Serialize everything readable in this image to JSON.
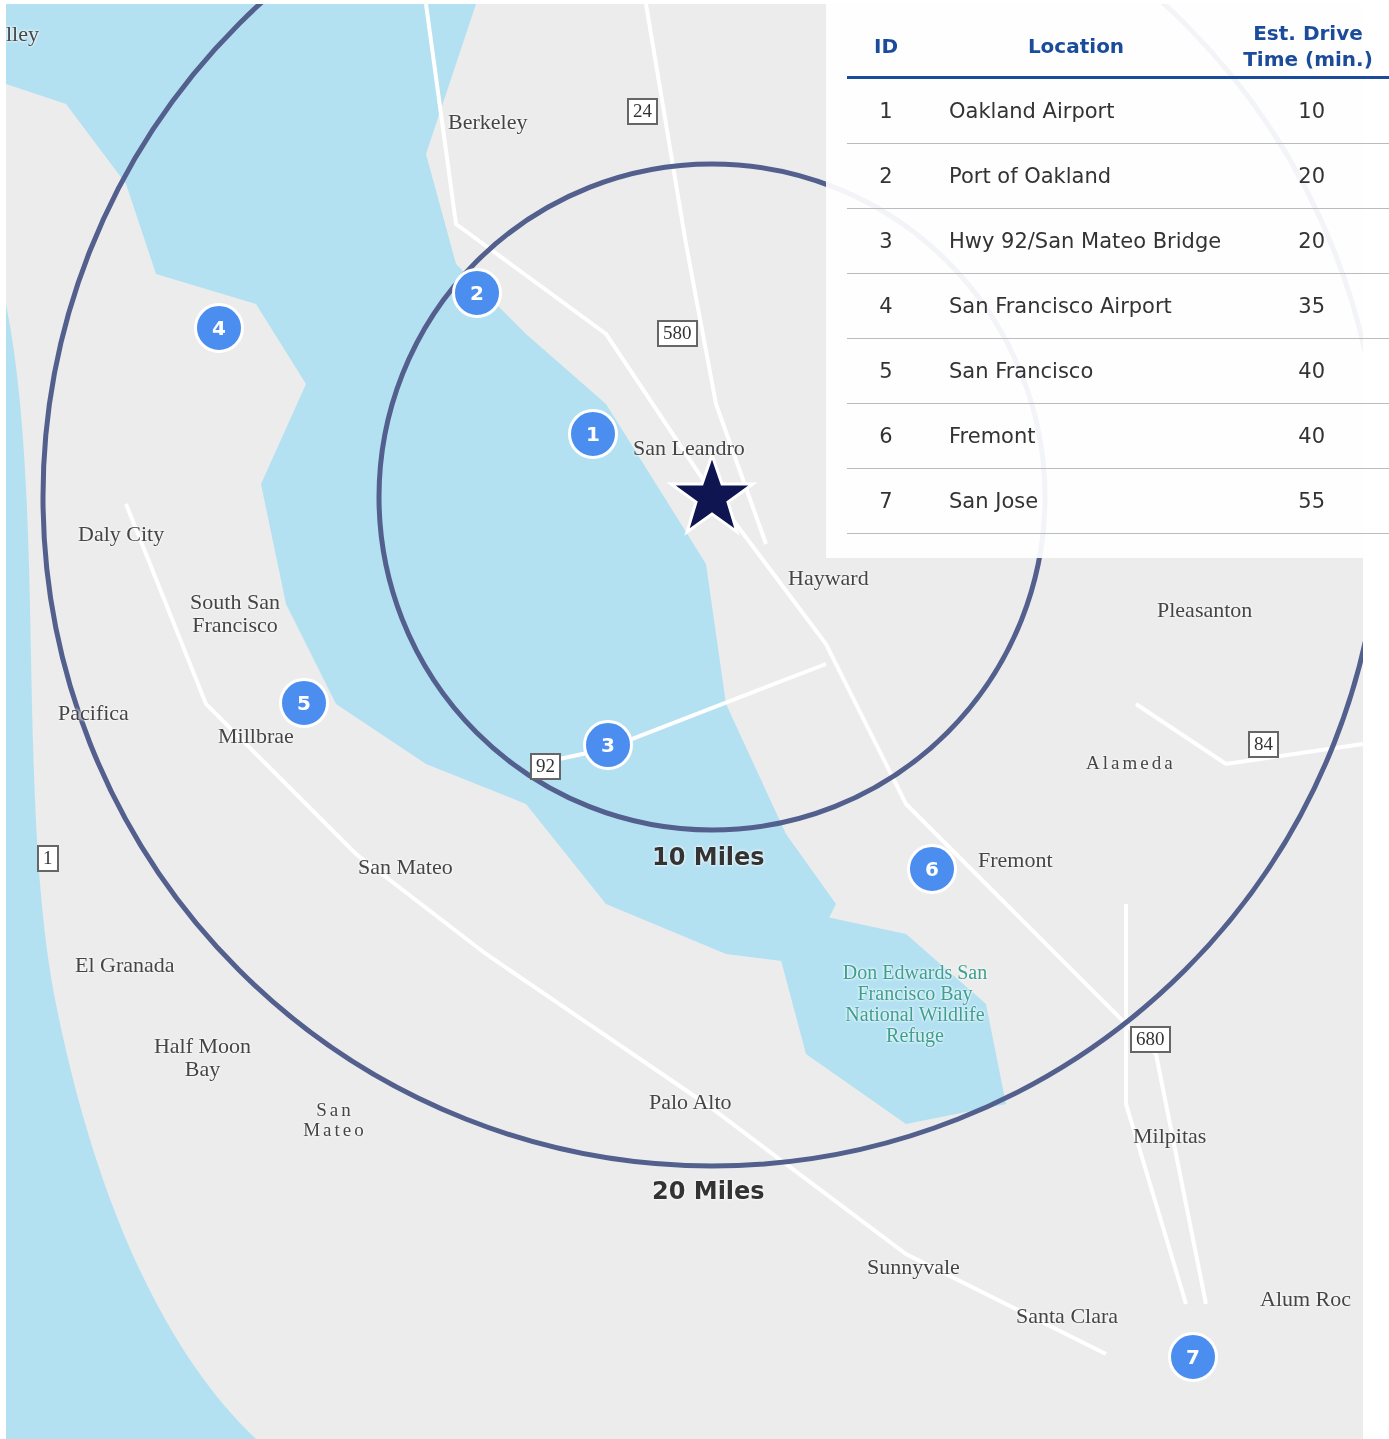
{
  "table": {
    "columns": [
      "ID",
      "Location",
      "Est. Drive Time (min.)"
    ],
    "rows": [
      {
        "id": "1",
        "location": "Oakland Airport",
        "time": "10"
      },
      {
        "id": "2",
        "location": "Port of Oakland",
        "time": "20"
      },
      {
        "id": "3",
        "location": "Hwy 92/San Mateo Bridge",
        "time": "20"
      },
      {
        "id": "4",
        "location": "San Francisco Airport",
        "time": "35"
      },
      {
        "id": "5",
        "location": "San Francisco",
        "time": "40"
      },
      {
        "id": "6",
        "location": "Fremont",
        "time": "40"
      },
      {
        "id": "7",
        "location": "San Jose",
        "time": "55"
      }
    ]
  },
  "rings": [
    {
      "label": "10 Miles"
    },
    {
      "label": "20 Miles"
    }
  ],
  "markers": [
    {
      "label": "1"
    },
    {
      "label": "2"
    },
    {
      "label": "3"
    },
    {
      "label": "4"
    },
    {
      "label": "5"
    },
    {
      "label": "6"
    },
    {
      "label": "7"
    }
  ],
  "place_labels": [
    "lley",
    "Berkeley",
    "San Leandro",
    "Hayward",
    "Pleasanton",
    "Daly City",
    "South San Francisco",
    "Pacifica",
    "Millbrae",
    "San Mateo",
    "Alameda",
    "Fremont",
    "El Granada",
    "Half Moon Bay",
    "San Mateo",
    "Don Edwards San Francisco Bay National Wildlife Refuge",
    "Palo Alto",
    "Milpitas",
    "Sunnyvale",
    "Santa Clara",
    "Alum Roc"
  ],
  "route_shields": [
    "24",
    "580",
    "92",
    "84",
    "1",
    "680"
  ]
}
